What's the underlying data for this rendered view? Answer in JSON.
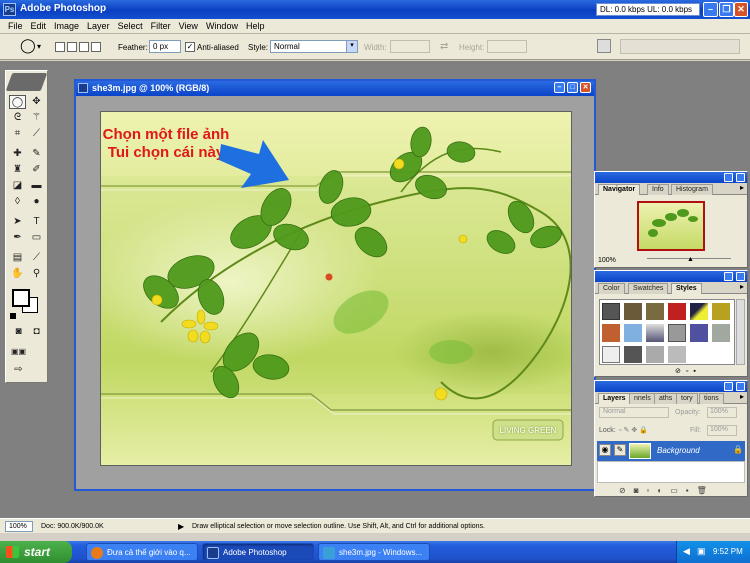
{
  "app": {
    "title": "Adobe Photoshop",
    "netspeed": "DL: 0.0 kbps  UL: 0.0 kbps"
  },
  "menu": [
    "File",
    "Edit",
    "Image",
    "Layer",
    "Select",
    "Filter",
    "View",
    "Window",
    "Help"
  ],
  "options": {
    "feather_label": "Feather:",
    "feather_value": "0 px",
    "antialiased_label": "Anti-aliased",
    "antialiased_checked": true,
    "style_label": "Style:",
    "style_value": "Normal",
    "width_label": "Width:",
    "height_label": "Height:"
  },
  "document": {
    "title": "she3m.jpg @ 100% (RGB/8)",
    "annotation_line1": "Chọn một file ảnh",
    "annotation_line2": "Tui chọn cái này",
    "image_text": "LIVING GREEN",
    "arrow_color": "#1e6fe0"
  },
  "navigator": {
    "tabs": [
      "Navigator",
      "Info",
      "Histogram"
    ],
    "zoom": "100%"
  },
  "styles_panel": {
    "tabs": [
      "Color",
      "Swatches",
      "Styles"
    ]
  },
  "layers": {
    "tabs": [
      "Layers",
      "nnels",
      "aths",
      "tory",
      "tions"
    ],
    "blend_mode": "Normal",
    "opacity_label": "Opacity:",
    "opacity_value": "100%",
    "lock_label": "Lock:",
    "fill_label": "Fill:",
    "fill_value": "100%",
    "layer_name": "Background"
  },
  "status": {
    "zoom": "100%",
    "doc_size": "Doc: 900.0K/900.0K",
    "hint": "Draw elliptical selection or move selection outline.  Use Shift, Alt, and Ctrl for additional options."
  },
  "taskbar": {
    "start_label": "start",
    "tasks": [
      {
        "label": "Đưa cả thế giới vào q..."
      },
      {
        "label": "Adobe Photoshop"
      },
      {
        "label": "she3m.jpg - Windows..."
      }
    ],
    "clock": "9:52 PM"
  },
  "colors": {
    "xp_blue": "#245ddb",
    "layer_selected": "#3169c6",
    "annotation_red": "#e01818"
  }
}
